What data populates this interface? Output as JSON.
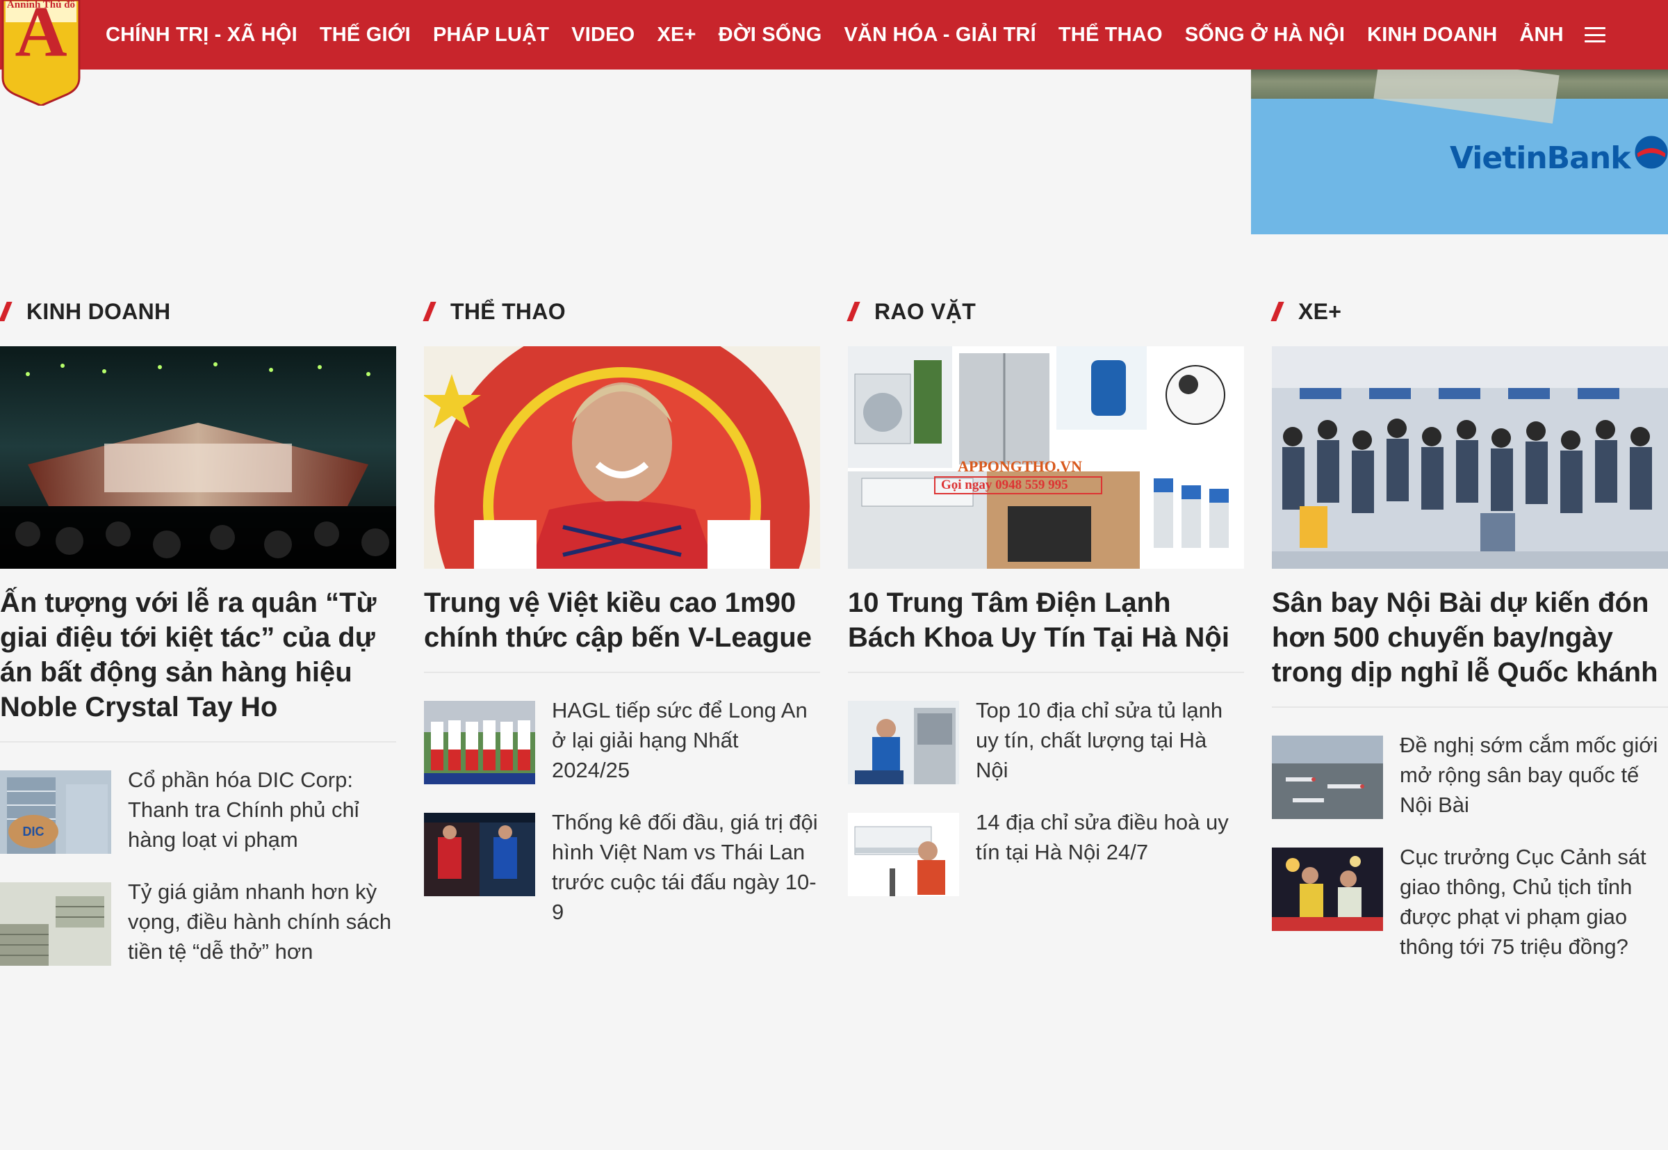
{
  "site": {
    "logo_text_top": "Anninh Thủ đô",
    "logo_letter": "A"
  },
  "nav": {
    "items": [
      "CHÍNH TRỊ - XÃ HỘI",
      "THẾ GIỚI",
      "PHÁP LUẬT",
      "VIDEO",
      "XE+",
      "ĐỜI SỐNG",
      "VĂN HÓA - GIẢI TRÍ",
      "THỂ THAO",
      "SỐNG Ở HÀ NỘI",
      "KINH DOANH",
      "ẢNH"
    ],
    "menu_icon": "hamburger-icon"
  },
  "banner": {
    "brand": "VietinBank"
  },
  "columns": [
    {
      "title": "KINH DOANH",
      "lead": {
        "title": "Ấn tượng với lễ ra quân “Từ giai điệu tới kiệt tác” của dự án bất động sản hàng hiệu Noble Crystal Tay Ho",
        "image": "concert-stage-image"
      },
      "items": [
        {
          "title": "Cổ phần hóa DIC Corp: Thanh tra Chính phủ chỉ hàng loạt vi phạm",
          "image": "dic-building-image"
        },
        {
          "title": "Tỷ giá giảm nhanh hơn kỳ vọng, điều hành chính sách tiền tệ “dễ thở” hơn",
          "image": "money-stacks-image"
        }
      ]
    },
    {
      "title": "THỂ THAO",
      "lead": {
        "title": "Trung vệ Việt kiều cao 1m90 chính thức cập bến V-League",
        "image": "footballer-portrait-image"
      },
      "items": [
        {
          "title": "HAGL tiếp sức để Long An ở lại giải hạng Nhất 2024/25",
          "image": "team-photo-image"
        },
        {
          "title": "Thống kê đối đầu, giá trị đội hình Việt Nam vs Thái Lan trước cuộc tái đấu ngày 10-9",
          "image": "match-graphic-image"
        }
      ]
    },
    {
      "title": "RAO VẶT",
      "lead": {
        "title": "10 Trung Tâm Điện Lạnh Bách Khoa Uy Tín Tại Hà Nội",
        "image": "appliances-collage-image",
        "image_caption": "APPONGTHO.VN",
        "image_phone": "Gọi ngay 0948 559 995"
      },
      "items": [
        {
          "title": "Top 10 địa chỉ sửa tủ lạnh uy tín, chất lượng tại Hà Nội",
          "image": "fridge-repair-image"
        },
        {
          "title": "14 địa chỉ sửa điều hoà uy tín tại Hà Nội 24/7",
          "image": "aircon-repair-image"
        }
      ]
    },
    {
      "title": "XE+",
      "lead": {
        "title": "Sân bay Nội Bài dự kiến đón hơn 500 chuyến bay/ngày trong dịp nghỉ lễ Quốc khánh",
        "image": "airport-crowd-image"
      },
      "items": [
        {
          "title": "Đề nghị sớm cắm mốc giới mở rộng sân bay quốc tế Nội Bài",
          "image": "airport-apron-image"
        },
        {
          "title": "Cục trưởng Cục Cảnh sát giao thông, Chủ tịch tỉnh được phạt vi phạm giao thông tới 75 triệu đồng?",
          "image": "traffic-police-image"
        }
      ]
    }
  ]
}
